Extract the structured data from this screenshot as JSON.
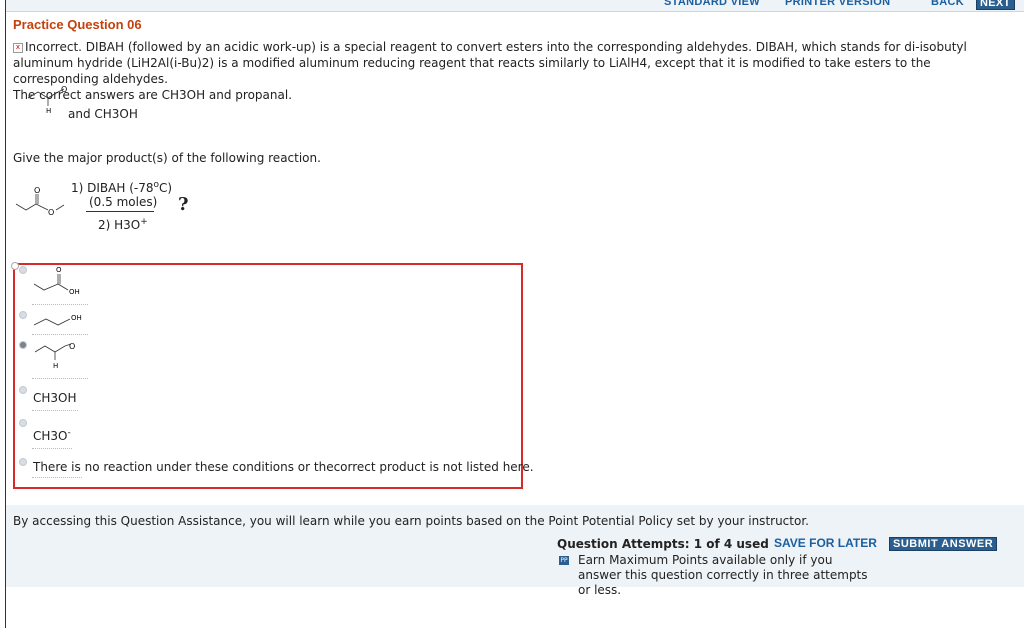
{
  "nav": {
    "standard_view": "STANDARD VIEW",
    "printer_version": "PRINTER VERSION",
    "back": "BACK",
    "next": "NEXT"
  },
  "question": {
    "title": "Practice Question 06",
    "feedback": "Incorrect. DIBAH (followed by an acidic work-up) is a special reagent to convert esters into the corresponding aldehydes. DIBAH, which stands for di-isobutyl aluminum hydride (LiH2Al(i-Bu)2) is a modified aluminum reducing reagent that reacts similarly to LiAlH4, except that it is modified to take esters to the corresponding aldehydes.",
    "correct_answers": "The correct answers are CH3OH and propanal.",
    "answer_suffix": "and CH3OH",
    "prompt": "Give the major product(s) of the following reaction.",
    "reagent_1": "1) DIBAH (-78",
    "reagent_1_sup": "o",
    "reagent_1_end": "C)",
    "reagent_moles": "(0.5 moles)",
    "reagent_2": "2) H3O",
    "reagent_2_sup": "+",
    "unknown": "?"
  },
  "choices": [
    {
      "type": "structure",
      "name": "propanoic-acid",
      "labels": [
        "O",
        "OH"
      ],
      "selected": false
    },
    {
      "type": "structure",
      "name": "propanol",
      "labels": [
        "OH"
      ],
      "selected": false
    },
    {
      "type": "structure",
      "name": "propanal",
      "labels": [
        "O",
        "H"
      ],
      "selected": true
    },
    {
      "type": "text",
      "label": "CH3OH",
      "selected": false
    },
    {
      "type": "text",
      "label": "CH3O",
      "label_sup": "-",
      "selected": false
    },
    {
      "type": "text",
      "label": "There is no reaction under these conditions or thecorrect product is not listed here.",
      "selected": false
    }
  ],
  "footer": {
    "disclaimer": "By accessing this Question Assistance, you will learn while you earn points based on the Point Potential Policy set by your instructor.",
    "attempts": "Question Attempts: 1 of 4 used",
    "save_later": "SAVE FOR LATER",
    "submit": "SUBMIT ANSWER",
    "earn": "Earn Maximum Points available only if you answer this question correctly in three attempts or less."
  },
  "colors": {
    "title": "#c2410c",
    "link": "#1a5fa0",
    "choice_border": "#d92a2a",
    "panel_bg": "#eef3f7"
  }
}
